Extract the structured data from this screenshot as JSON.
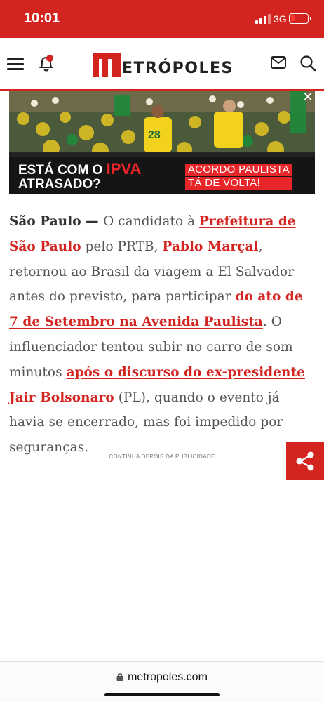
{
  "status_bar": {
    "time": "10:01",
    "network": "3G"
  },
  "header": {
    "logo_text": "ETRÓPOLES",
    "icons": [
      "menu-icon",
      "bell-icon",
      "mail-icon",
      "search-icon"
    ]
  },
  "ad": {
    "headline_line1": "ESTÁ COM O ",
    "headline_highlight": "IPVA",
    "headline_line2": "ATRASADO?",
    "tag1": "ACORDO PAULISTA",
    "tag2": "TÁ DE VOLTA!",
    "close": "✕"
  },
  "article": {
    "dateline": "São Paulo",
    "dash": " — ",
    "t1": "O candidato à ",
    "l1": "Prefeitura de São Paulo",
    "t2": " pelo PRTB, ",
    "l2": "Pablo Marçal",
    "t3": ", retornou ao Brasil da viagem a El Salvador antes do previsto, para participar ",
    "l3": "do ato de 7 de Setembro na Avenida Paulista",
    "t4": ". O influenciador tentou subir no carro de som minutos ",
    "l4": "após o discurso do ex-presidente",
    "t5": " ",
    "l5": "Jair Bolsonaro",
    "t6": " (PL), quando o evento já havia se encerrado, mas foi impedido por seguranças."
  },
  "ad_note": "CONTINUA DEPOIS DA PUBLICIDADE",
  "url_bar": {
    "url": "metropoles.com"
  },
  "colors": {
    "brand_red": "#d32420",
    "link_red": "#d32420"
  }
}
